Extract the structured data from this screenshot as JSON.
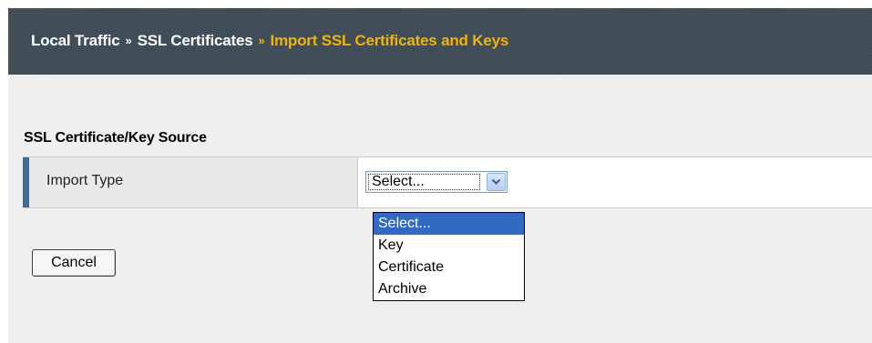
{
  "breadcrumb": {
    "items": [
      "Local Traffic",
      "SSL Certificates",
      "Import SSL Certificates and Keys"
    ],
    "separator": "»"
  },
  "section": {
    "title": "SSL Certificate/Key Source"
  },
  "import_type": {
    "label": "Import Type",
    "selected_value": "Select...",
    "options": [
      "Select...",
      "Key",
      "Certificate",
      "Archive"
    ],
    "highlighted_index": 0
  },
  "actions": {
    "cancel_label": "Cancel"
  },
  "colors": {
    "header_bg": "#3e4a55",
    "breadcrumb_current": "#f3b400",
    "row_accent": "#3e6d9a",
    "option_highlight": "#316ac5"
  },
  "icons": {
    "select_arrow": "chevron-down-icon"
  }
}
